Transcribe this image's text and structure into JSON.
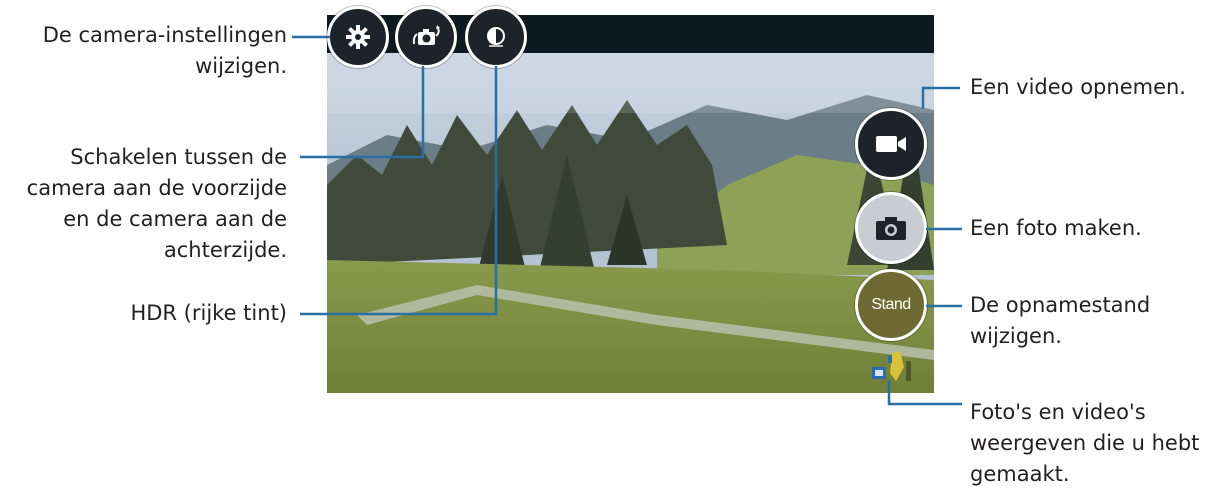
{
  "camera": {
    "top_buttons": [
      {
        "name": "settings",
        "icon": "gear-icon"
      },
      {
        "name": "switch-camera",
        "icon": "switch-camera-icon"
      },
      {
        "name": "hdr",
        "icon": "hdr-icon"
      }
    ],
    "side_buttons": {
      "video": {
        "icon": "video-camera-icon"
      },
      "photo": {
        "icon": "camera-icon"
      },
      "mode": {
        "label": "Stand"
      }
    },
    "gallery": {
      "icon": "gallery-thumbnail-icon"
    }
  },
  "callouts": {
    "settings": "De camera-instellingen\nwijzigen.",
    "switch_camera": "Schakelen tussen de\ncamera aan de voorzijde\nen de camera aan de\nachterzijde.",
    "hdr": "HDR (rijke tint)",
    "video": "Een video opnemen.",
    "photo": "Een foto maken.",
    "mode": "De opnamestand\nwijzigen.",
    "gallery": "Foto's en video's\nweergeven die u hebt\ngemaakt."
  },
  "colors": {
    "leader_line": "#2a6ea6",
    "button_dark": "#1c232a",
    "button_light": "#c9cdd1",
    "button_mode": "#6f6a33",
    "button_ring": "#ffffff",
    "text": "#231f20"
  }
}
